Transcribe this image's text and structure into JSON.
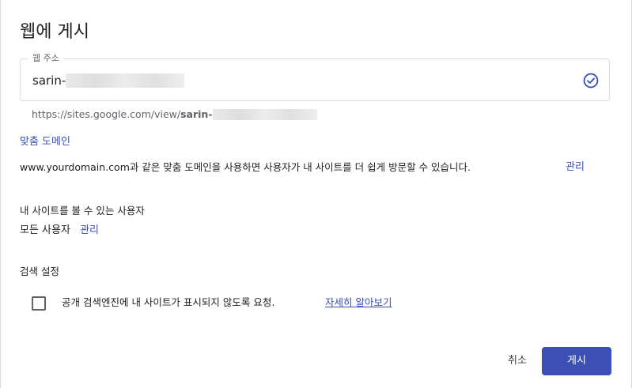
{
  "dialog": {
    "title": "웹에 게시"
  },
  "url_field": {
    "label": "웹 주소",
    "value": "sarin-",
    "status_icon": "check-circle-icon"
  },
  "full_url": {
    "prefix": "https://sites.google.com/view/",
    "bold": "sarin-"
  },
  "custom_domain": {
    "title": "맞춤 도메인",
    "description": "www.yourdomain.com과 같은 맞춤 도메인을 사용하면 사용자가 내 사이트를 더 쉽게 방문할 수 있습니다.",
    "manage_label": "관리"
  },
  "viewers": {
    "title": "내 사이트를 볼 수 있는 사용자",
    "value": "모든 사용자",
    "manage_label": "관리"
  },
  "search": {
    "title": "검색 설정",
    "checkbox_label": "공개 검색엔진에 내 사이트가 표시되지 않도록 요청.",
    "checkbox_checked": false,
    "learn_more": "자세히 알아보기"
  },
  "actions": {
    "cancel_label": "취소",
    "publish_label": "게시"
  },
  "colors": {
    "accent": "#3c4fb4",
    "border": "#dadce0",
    "muted_text": "#5f6368"
  }
}
